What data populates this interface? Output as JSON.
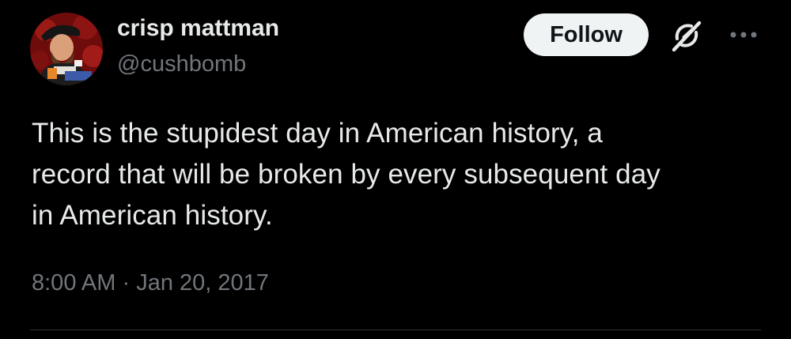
{
  "author": {
    "display_name": "crisp mattman",
    "handle": "@cushbomb",
    "avatar_icon": "avatar-portrait"
  },
  "actions": {
    "follow_label": "Follow",
    "grok_icon": "grok-icon",
    "more_icon": "more-icon"
  },
  "tweet": {
    "lines": [
      "This is the stupidest day in American history, a",
      "record that will be broken by every subsequent day",
      "in American history."
    ],
    "time": "8:00 AM",
    "separator": "·",
    "date": "Jan 20, 2017"
  },
  "colors": {
    "background": "#000000",
    "primary_text": "#e7e9ea",
    "secondary_text": "#71767b",
    "follow_bg": "#eff3f4",
    "divider": "#2f3336"
  }
}
